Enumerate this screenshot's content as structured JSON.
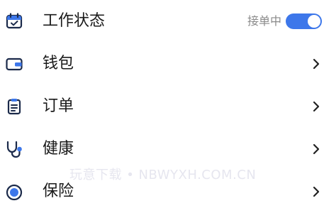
{
  "menu": {
    "items": [
      {
        "label": "工作状态",
        "icon": "calendar-check-icon",
        "status_text": "接单中",
        "toggle_on": true
      },
      {
        "label": "钱包",
        "icon": "wallet-icon"
      },
      {
        "label": "订单",
        "icon": "order-list-icon"
      },
      {
        "label": "健康",
        "icon": "stethoscope-icon"
      },
      {
        "label": "保险",
        "icon": "shield-icon"
      }
    ]
  },
  "watermark": "玩意下载 • NBWYXH.COM.CN",
  "colors": {
    "accent": "#3d77ea",
    "icon_dark": "#1b2a4a",
    "label": "#1a1a1a",
    "muted": "#8a8a8a"
  }
}
